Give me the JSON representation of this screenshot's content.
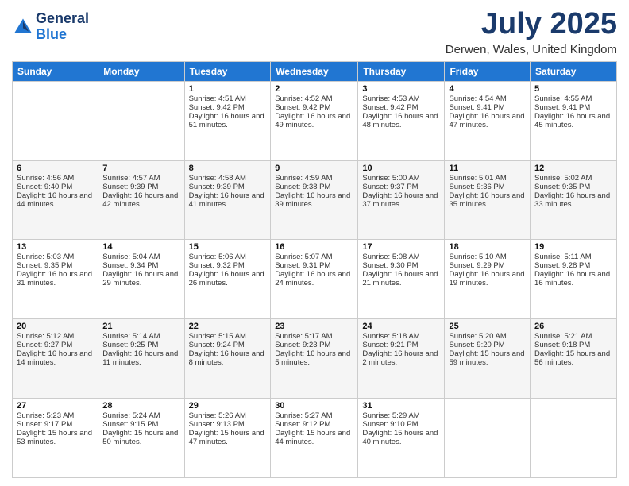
{
  "header": {
    "logo_line1": "General",
    "logo_line2": "Blue",
    "month_title": "July 2025",
    "location": "Derwen, Wales, United Kingdom"
  },
  "days_of_week": [
    "Sunday",
    "Monday",
    "Tuesday",
    "Wednesday",
    "Thursday",
    "Friday",
    "Saturday"
  ],
  "weeks": [
    [
      {
        "day": "",
        "sunrise": "",
        "sunset": "",
        "daylight": ""
      },
      {
        "day": "",
        "sunrise": "",
        "sunset": "",
        "daylight": ""
      },
      {
        "day": "1",
        "sunrise": "Sunrise: 4:51 AM",
        "sunset": "Sunset: 9:42 PM",
        "daylight": "Daylight: 16 hours and 51 minutes."
      },
      {
        "day": "2",
        "sunrise": "Sunrise: 4:52 AM",
        "sunset": "Sunset: 9:42 PM",
        "daylight": "Daylight: 16 hours and 49 minutes."
      },
      {
        "day": "3",
        "sunrise": "Sunrise: 4:53 AM",
        "sunset": "Sunset: 9:42 PM",
        "daylight": "Daylight: 16 hours and 48 minutes."
      },
      {
        "day": "4",
        "sunrise": "Sunrise: 4:54 AM",
        "sunset": "Sunset: 9:41 PM",
        "daylight": "Daylight: 16 hours and 47 minutes."
      },
      {
        "day": "5",
        "sunrise": "Sunrise: 4:55 AM",
        "sunset": "Sunset: 9:41 PM",
        "daylight": "Daylight: 16 hours and 45 minutes."
      }
    ],
    [
      {
        "day": "6",
        "sunrise": "Sunrise: 4:56 AM",
        "sunset": "Sunset: 9:40 PM",
        "daylight": "Daylight: 16 hours and 44 minutes."
      },
      {
        "day": "7",
        "sunrise": "Sunrise: 4:57 AM",
        "sunset": "Sunset: 9:39 PM",
        "daylight": "Daylight: 16 hours and 42 minutes."
      },
      {
        "day": "8",
        "sunrise": "Sunrise: 4:58 AM",
        "sunset": "Sunset: 9:39 PM",
        "daylight": "Daylight: 16 hours and 41 minutes."
      },
      {
        "day": "9",
        "sunrise": "Sunrise: 4:59 AM",
        "sunset": "Sunset: 9:38 PM",
        "daylight": "Daylight: 16 hours and 39 minutes."
      },
      {
        "day": "10",
        "sunrise": "Sunrise: 5:00 AM",
        "sunset": "Sunset: 9:37 PM",
        "daylight": "Daylight: 16 hours and 37 minutes."
      },
      {
        "day": "11",
        "sunrise": "Sunrise: 5:01 AM",
        "sunset": "Sunset: 9:36 PM",
        "daylight": "Daylight: 16 hours and 35 minutes."
      },
      {
        "day": "12",
        "sunrise": "Sunrise: 5:02 AM",
        "sunset": "Sunset: 9:35 PM",
        "daylight": "Daylight: 16 hours and 33 minutes."
      }
    ],
    [
      {
        "day": "13",
        "sunrise": "Sunrise: 5:03 AM",
        "sunset": "Sunset: 9:35 PM",
        "daylight": "Daylight: 16 hours and 31 minutes."
      },
      {
        "day": "14",
        "sunrise": "Sunrise: 5:04 AM",
        "sunset": "Sunset: 9:34 PM",
        "daylight": "Daylight: 16 hours and 29 minutes."
      },
      {
        "day": "15",
        "sunrise": "Sunrise: 5:06 AM",
        "sunset": "Sunset: 9:32 PM",
        "daylight": "Daylight: 16 hours and 26 minutes."
      },
      {
        "day": "16",
        "sunrise": "Sunrise: 5:07 AM",
        "sunset": "Sunset: 9:31 PM",
        "daylight": "Daylight: 16 hours and 24 minutes."
      },
      {
        "day": "17",
        "sunrise": "Sunrise: 5:08 AM",
        "sunset": "Sunset: 9:30 PM",
        "daylight": "Daylight: 16 hours and 21 minutes."
      },
      {
        "day": "18",
        "sunrise": "Sunrise: 5:10 AM",
        "sunset": "Sunset: 9:29 PM",
        "daylight": "Daylight: 16 hours and 19 minutes."
      },
      {
        "day": "19",
        "sunrise": "Sunrise: 5:11 AM",
        "sunset": "Sunset: 9:28 PM",
        "daylight": "Daylight: 16 hours and 16 minutes."
      }
    ],
    [
      {
        "day": "20",
        "sunrise": "Sunrise: 5:12 AM",
        "sunset": "Sunset: 9:27 PM",
        "daylight": "Daylight: 16 hours and 14 minutes."
      },
      {
        "day": "21",
        "sunrise": "Sunrise: 5:14 AM",
        "sunset": "Sunset: 9:25 PM",
        "daylight": "Daylight: 16 hours and 11 minutes."
      },
      {
        "day": "22",
        "sunrise": "Sunrise: 5:15 AM",
        "sunset": "Sunset: 9:24 PM",
        "daylight": "Daylight: 16 hours and 8 minutes."
      },
      {
        "day": "23",
        "sunrise": "Sunrise: 5:17 AM",
        "sunset": "Sunset: 9:23 PM",
        "daylight": "Daylight: 16 hours and 5 minutes."
      },
      {
        "day": "24",
        "sunrise": "Sunrise: 5:18 AM",
        "sunset": "Sunset: 9:21 PM",
        "daylight": "Daylight: 16 hours and 2 minutes."
      },
      {
        "day": "25",
        "sunrise": "Sunrise: 5:20 AM",
        "sunset": "Sunset: 9:20 PM",
        "daylight": "Daylight: 15 hours and 59 minutes."
      },
      {
        "day": "26",
        "sunrise": "Sunrise: 5:21 AM",
        "sunset": "Sunset: 9:18 PM",
        "daylight": "Daylight: 15 hours and 56 minutes."
      }
    ],
    [
      {
        "day": "27",
        "sunrise": "Sunrise: 5:23 AM",
        "sunset": "Sunset: 9:17 PM",
        "daylight": "Daylight: 15 hours and 53 minutes."
      },
      {
        "day": "28",
        "sunrise": "Sunrise: 5:24 AM",
        "sunset": "Sunset: 9:15 PM",
        "daylight": "Daylight: 15 hours and 50 minutes."
      },
      {
        "day": "29",
        "sunrise": "Sunrise: 5:26 AM",
        "sunset": "Sunset: 9:13 PM",
        "daylight": "Daylight: 15 hours and 47 minutes."
      },
      {
        "day": "30",
        "sunrise": "Sunrise: 5:27 AM",
        "sunset": "Sunset: 9:12 PM",
        "daylight": "Daylight: 15 hours and 44 minutes."
      },
      {
        "day": "31",
        "sunrise": "Sunrise: 5:29 AM",
        "sunset": "Sunset: 9:10 PM",
        "daylight": "Daylight: 15 hours and 40 minutes."
      },
      {
        "day": "",
        "sunrise": "",
        "sunset": "",
        "daylight": ""
      },
      {
        "day": "",
        "sunrise": "",
        "sunset": "",
        "daylight": ""
      }
    ]
  ]
}
